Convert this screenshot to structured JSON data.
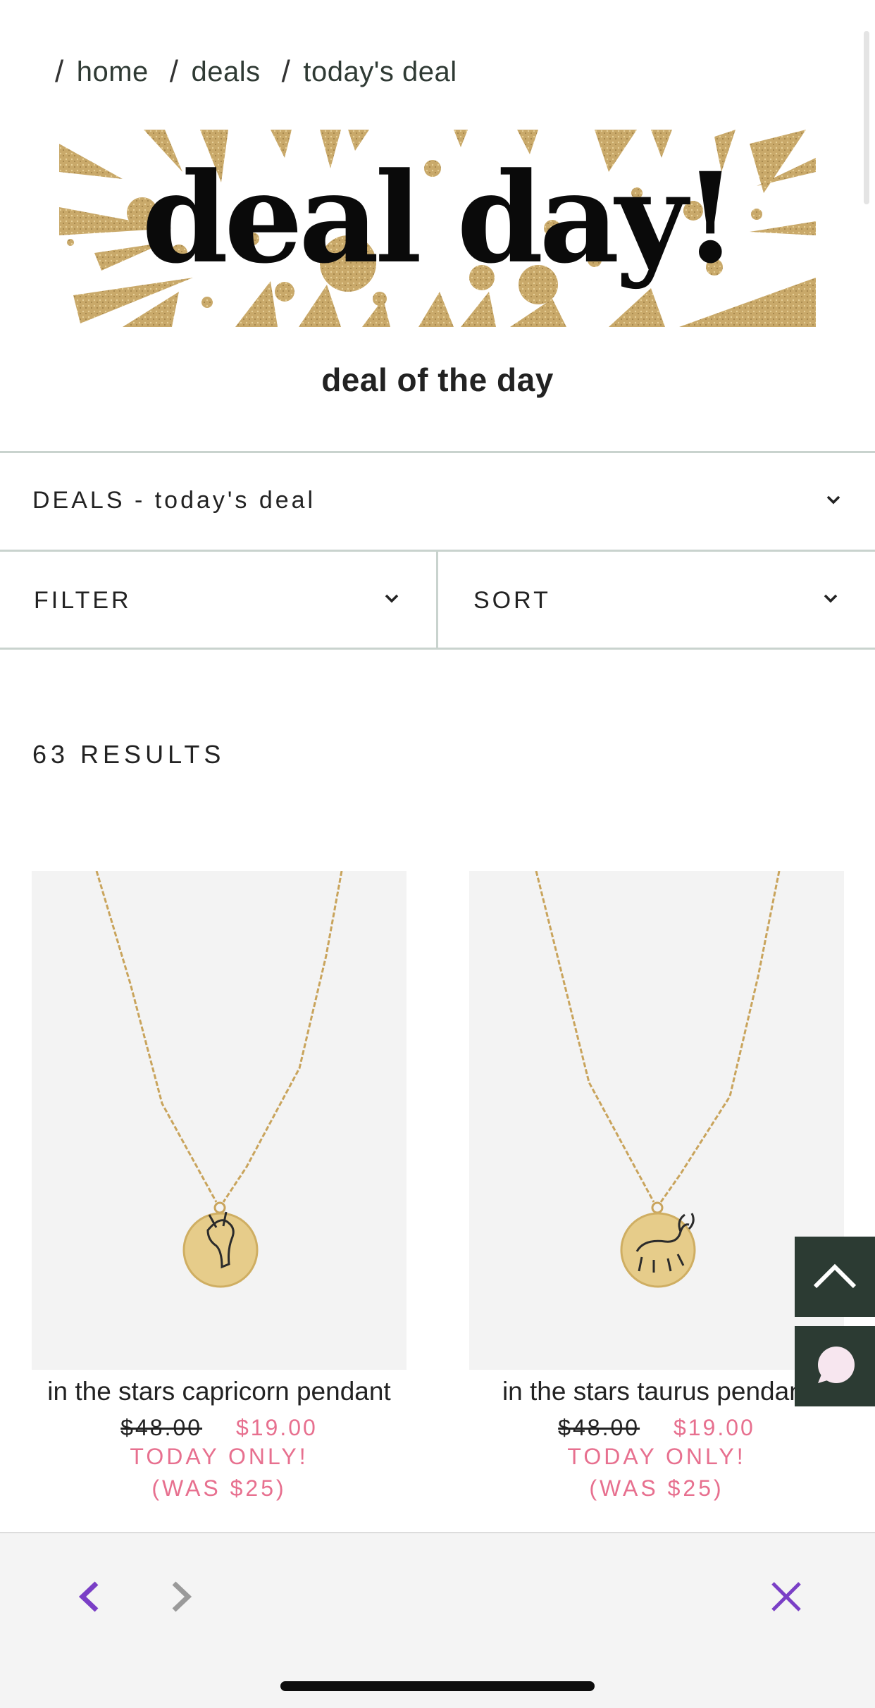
{
  "breadcrumb": {
    "items": [
      "home",
      "deals",
      "today's deal"
    ],
    "separator": "/"
  },
  "banner": {
    "title": "deal day!",
    "glitter_color": "#c9a96a"
  },
  "page": {
    "subtitle": "deal of the day"
  },
  "category_select": {
    "label": "DEALS - today's deal",
    "icon": "chevron-down-icon"
  },
  "filter": {
    "label": "FILTER",
    "icon": "chevron-down-icon"
  },
  "sort": {
    "label": "SORT",
    "icon": "chevron-down-icon"
  },
  "results": {
    "count_label": "63 RESULTS"
  },
  "products": [
    {
      "name": "in the stars capricorn pendant",
      "original_price": "$48.00",
      "sale_price": "$19.00",
      "promo_line1": "TODAY ONLY!",
      "promo_line2": "(WAS $25)",
      "image": "gold-necklace-capricorn-pendant"
    },
    {
      "name": "in the stars taurus pendant",
      "original_price": "$48.00",
      "sale_price": "$19.00",
      "promo_line1": "TODAY ONLY!",
      "promo_line2": "(WAS $25)",
      "image": "gold-necklace-taurus-pendant"
    }
  ],
  "floating": {
    "scroll_top_icon": "chevron-up-icon",
    "chat_icon": "chat-bubble-icon",
    "bg_color": "#2c3b33"
  },
  "browser_bar": {
    "back_icon": "chevron-left-icon",
    "forward_icon": "chevron-right-icon",
    "close_icon": "close-icon",
    "accent_color": "#7a3fc6"
  },
  "colors": {
    "sale": "#e7708f",
    "divider": "#c9d3ce"
  }
}
